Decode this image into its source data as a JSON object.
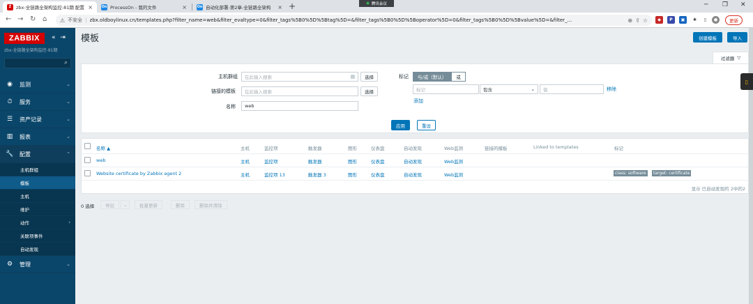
{
  "browser": {
    "tabs": [
      {
        "title": "zbx-全链路全架构监控-81期 配置",
        "favicon": "Z",
        "color": "#d40000"
      },
      {
        "title": "ProcessOn - 我的文件",
        "favicon": "On",
        "color": "#1e88e5"
      },
      {
        "title": "自动化部署-第2章-全链路全架构",
        "favicon": "On",
        "color": "#1e88e5"
      }
    ],
    "meeting": "腾讯会议",
    "insecure": "不安全",
    "url": "zbx.oldboylinux.cn/templates.php?filter_name=web&filter_evaltype=0&filter_tags%5B0%5D%5Btag%5D=&filter_tags%5B0%5D%5Boperator%5D=0&filter_tags%5B0%5D%5Bvalue%5D=&filter_...",
    "update_label": "更新"
  },
  "sidebar": {
    "logo": "ZABBIX",
    "subtitle": "zbx-全链路全架构监控-81期",
    "menu": [
      {
        "label": "监测",
        "icon": "eye-icon"
      },
      {
        "label": "服务",
        "icon": "clock-icon"
      },
      {
        "label": "资产记录",
        "icon": "list-icon"
      },
      {
        "label": "报表",
        "icon": "bar-chart-icon"
      },
      {
        "label": "配置",
        "icon": "wrench-icon"
      }
    ],
    "submenu": [
      "主机群组",
      "模板",
      "主机",
      "维护",
      "动作",
      "关联项事件",
      "自动发现"
    ],
    "admin": {
      "label": "管理",
      "icon": "gear-icon"
    }
  },
  "page": {
    "title": "模板",
    "create_button": "创建模板",
    "import_button": "导入",
    "filter_tab": "过滤器"
  },
  "filter": {
    "host_groups_label": "主机群组",
    "host_groups_placeholder": "在此输入搜索",
    "linked_templates_label": "链接的模板",
    "linked_templates_placeholder": "在此输入搜索",
    "name_label": "名称",
    "name_value": "web",
    "select_label": "选择",
    "tags_label": "标记",
    "tags_mode_and": "与/或（默认）",
    "tags_mode_or": "或",
    "tag_placeholder": "标记",
    "operator": "包含",
    "value_placeholder": "值",
    "remove": "移除",
    "add": "添加",
    "apply": "应用",
    "reset": "重设"
  },
  "table": {
    "headers": [
      "名称 ▲",
      "主机",
      "监控项",
      "触发器",
      "图形",
      "仪表盘",
      "自动发现",
      "Web监测",
      "链接的模板",
      "Linked to templates",
      "标记"
    ],
    "rows": [
      {
        "name": "web",
        "hosts": "主机",
        "items": "监控项",
        "triggers": "触发器",
        "graphs": "图形",
        "dashboards": "仪表盘",
        "discovery": "自动发现",
        "web": "Web监测",
        "tags": []
      },
      {
        "name": "Website certificate by Zabbix agent 2",
        "hosts": "主机",
        "items": "监控项 13",
        "triggers": "触发器 3",
        "graphs": "图形",
        "dashboards": "仪表盘",
        "discovery": "自动发现",
        "web": "Web监测",
        "tags": [
          "class: software",
          "target: certificate"
        ]
      }
    ],
    "footer": "显示 已自动发现的 2中的2"
  },
  "bulk": {
    "selected": "0 选择",
    "export": "导出",
    "mass_update": "批量更新",
    "delete": "删除",
    "delete_clear": "删除并清除"
  }
}
